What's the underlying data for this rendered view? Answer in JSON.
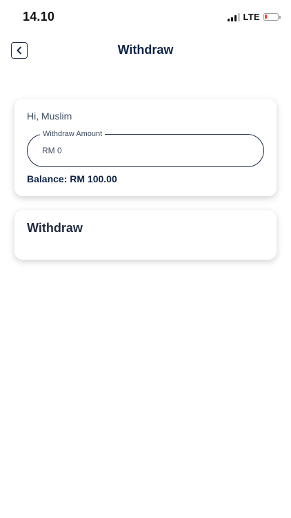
{
  "status_bar": {
    "time": "14.10",
    "network": "LTE",
    "battery_level": 0.15,
    "battery_color": "#ff3b30"
  },
  "header": {
    "back_icon": "chevron-left-icon",
    "title": "Withdraw"
  },
  "form": {
    "greeting": "Hi, Muslim",
    "amount_label": "Withdraw Amount",
    "amount_value": "RM 0",
    "balance": "Balance: RM 100.00"
  },
  "action": {
    "withdraw_label": "Withdraw"
  },
  "colors": {
    "primary": "#0f2447",
    "text_secondary": "#3c4a60"
  }
}
